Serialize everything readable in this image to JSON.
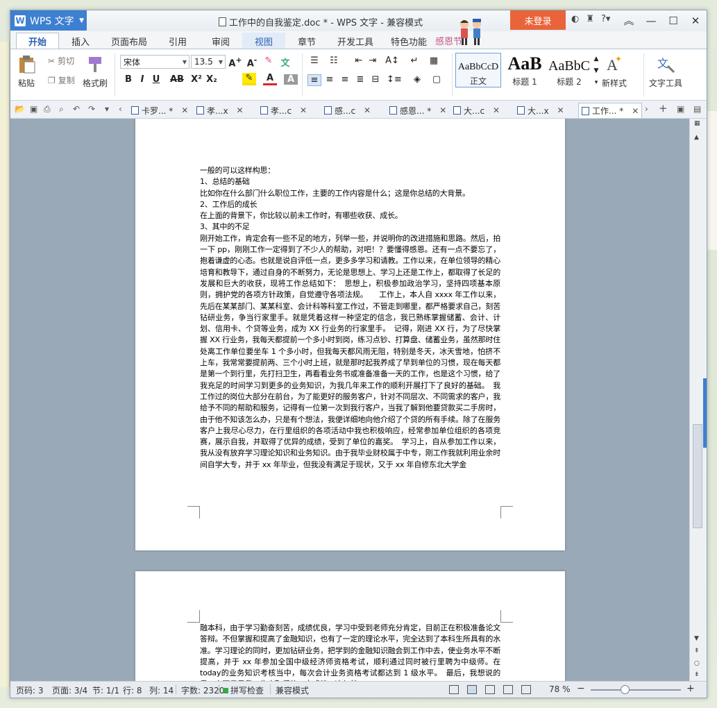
{
  "window": {
    "app_name": "WPS 文字",
    "doc_title": "工作中的自我鉴定.doc * - WPS 文字 - 兼容模式",
    "login": "未登录"
  },
  "ribbon_tabs": [
    "开始",
    "插入",
    "页面布局",
    "引用",
    "审阅",
    "视图",
    "章节",
    "开发工具",
    "特色功能"
  ],
  "festival_label": "感恩节",
  "ribbon": {
    "paste": "粘贴",
    "cut": "剪切",
    "copy": "复制",
    "format_painter": "格式刷",
    "font_name": "宋体",
    "font_size": "13.5",
    "styles": [
      {
        "preview": "AaBbCcD",
        "label": "正文"
      },
      {
        "preview": "AaB",
        "label": "标题 1"
      },
      {
        "preview": "AaBbC",
        "label": "标题 2"
      }
    ],
    "new_style": "新样式",
    "text_tools": "文字工具"
  },
  "doc_tabs": [
    {
      "label": "卡罗... *",
      "active": false
    },
    {
      "label": "孝...x",
      "active": false
    },
    {
      "label": "孝...c",
      "active": false
    },
    {
      "label": "感...c",
      "active": false
    },
    {
      "label": "感恩... *",
      "active": false
    },
    {
      "label": "大...c",
      "active": false
    },
    {
      "label": "大...x",
      "active": false
    },
    {
      "label": "工作... *",
      "active": true
    }
  ],
  "page1_text": "一般的可以这样构思：\n1、总结的基础\n比如你在什么部门什么职位工作，主要的工作内容是什么；这是你总结的大背景。\n2、工作后的成长\n在上面的背景下，你比较以前未工作时，有哪些收获、成长。\n3、其中的不足\n刚开始工作，肯定会有一些不足的地方，列举一些，并说明你的改进措施和思路。然后，拍一下 pp，刚刚工作一定得到了不少人的帮助，对吧！？要懂得感恩。还有一点不要忘了，抱着谦虚的心态。也就是说自评低一点，更多多学习和请教。工作以来，在单位领导的精心培育和教导下，通过自身的不断努力，无论是思想上、学习上还是工作上，都取得了长足的发展和巨大的收获，现将工作总结如下：　思想上，积极参加政治学习，坚持四项基本原则，拥护党的各项方针政策，自觉遵守各项法规。　　工作上，本人自 xxxx 年工作以来，先后在某某部门、某某科室、会计科等科室工作过，不管走到哪里，都严格要求自己，刻苦钻研业务，争当行家里手。就是凭着这样一种坚定的信念，我已熟练掌握储蓄、会计、计划、信用卡、个贷等业务，成为 XX 行业务的行家里手。　记得，刚进 XX 行，为了尽快掌握 XX 行业务，我每天都提前一个多小时到岗，练习点钞、打算盘、储蓄业务，虽然那时住处离工作单位要坐车 1 个多小时，但我每天都风雨无阻，特别是冬天，冰天雪地，怕挤不上车，我常常要提前两、三个小时上班，就是那时起我养成了早到单位的习惯，现在每天都是第一个到行里，先打扫卫生，再看看业务书或准备准备一天的工作，也是这个习惯，给了我充足的时间学习到更多的业务知识，为我几年来工作的顺利开展打下了良好的基础。　我工作过的岗位大部分在前台，为了能更好的服务客户，针对不同层次、不同需求的客户，我给予不同的帮助和服务，记得有一位第一次到我行客户，当我了解到他要贷款买二手房时，由于他不知该怎么办，只是有个想法，我便详细地向他介绍了个贷的所有手续。除了在服务客户上我尽心尽力，在行里组织的各项活动中我也积极响应，经常参加单位组织的各项竞赛，展示自我，并取得了优异的成绩，受到了单位的嘉奖。　学习上，自从参加工作以来，我从没有放弃学习理论知识和业务知识。由于我毕业财校属于中专，刚工作我就利用业余时间自学大专，并于 xx 年毕业，但我没有满足于现状，又于 xx 年自修东北大学金",
  "page2_text": "融本科，由于学习勤奋刻苦，成绩优良，学习中受到老师充分肯定，目前正在积极准备论文答辩。不但掌握和提高了金融知识，也有了一定的理论水平，完全达到了本科生所具有的水准。学习理论的同时，更加钻研业务，把学到的金融知识融会到工作中去，使业务水平不断提高，并于 xx 年参加全国中级经济师资格考试，顺利通过同时被行里聘为中级师。在today的业务知识考核当中，每次会计业务资格考试都达到 1 级水平。　最后，我想说的是，上面只是我工作中取得的一点成绩，这与单",
  "status": {
    "page": "页码: 3",
    "pages": "页面: 3/4",
    "section": "节: 1/1",
    "row": "行: 8",
    "col": "列: 14",
    "words": "字数: 2320",
    "spell": "拼写检查",
    "mode": "兼容模式",
    "zoom": "78 %"
  }
}
